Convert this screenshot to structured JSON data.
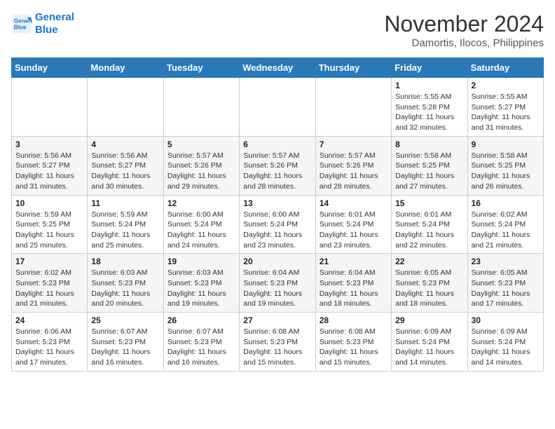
{
  "logo": {
    "line1": "General",
    "line2": "Blue"
  },
  "title": "November 2024",
  "subtitle": "Damortis, Ilocos, Philippines",
  "days_of_week": [
    "Sunday",
    "Monday",
    "Tuesday",
    "Wednesday",
    "Thursday",
    "Friday",
    "Saturday"
  ],
  "weeks": [
    [
      {
        "day": "",
        "info": ""
      },
      {
        "day": "",
        "info": ""
      },
      {
        "day": "",
        "info": ""
      },
      {
        "day": "",
        "info": ""
      },
      {
        "day": "",
        "info": ""
      },
      {
        "day": "1",
        "info": "Sunrise: 5:55 AM\nSunset: 5:28 PM\nDaylight: 11 hours and 32 minutes."
      },
      {
        "day": "2",
        "info": "Sunrise: 5:55 AM\nSunset: 5:27 PM\nDaylight: 11 hours and 31 minutes."
      }
    ],
    [
      {
        "day": "3",
        "info": "Sunrise: 5:56 AM\nSunset: 5:27 PM\nDaylight: 11 hours and 31 minutes."
      },
      {
        "day": "4",
        "info": "Sunrise: 5:56 AM\nSunset: 5:27 PM\nDaylight: 11 hours and 30 minutes."
      },
      {
        "day": "5",
        "info": "Sunrise: 5:57 AM\nSunset: 5:26 PM\nDaylight: 11 hours and 29 minutes."
      },
      {
        "day": "6",
        "info": "Sunrise: 5:57 AM\nSunset: 5:26 PM\nDaylight: 11 hours and 28 minutes."
      },
      {
        "day": "7",
        "info": "Sunrise: 5:57 AM\nSunset: 5:26 PM\nDaylight: 11 hours and 28 minutes."
      },
      {
        "day": "8",
        "info": "Sunrise: 5:58 AM\nSunset: 5:25 PM\nDaylight: 11 hours and 27 minutes."
      },
      {
        "day": "9",
        "info": "Sunrise: 5:58 AM\nSunset: 5:25 PM\nDaylight: 11 hours and 26 minutes."
      }
    ],
    [
      {
        "day": "10",
        "info": "Sunrise: 5:59 AM\nSunset: 5:25 PM\nDaylight: 11 hours and 25 minutes."
      },
      {
        "day": "11",
        "info": "Sunrise: 5:59 AM\nSunset: 5:24 PM\nDaylight: 11 hours and 25 minutes."
      },
      {
        "day": "12",
        "info": "Sunrise: 6:00 AM\nSunset: 5:24 PM\nDaylight: 11 hours and 24 minutes."
      },
      {
        "day": "13",
        "info": "Sunrise: 6:00 AM\nSunset: 5:24 PM\nDaylight: 11 hours and 23 minutes."
      },
      {
        "day": "14",
        "info": "Sunrise: 6:01 AM\nSunset: 5:24 PM\nDaylight: 11 hours and 23 minutes."
      },
      {
        "day": "15",
        "info": "Sunrise: 6:01 AM\nSunset: 5:24 PM\nDaylight: 11 hours and 22 minutes."
      },
      {
        "day": "16",
        "info": "Sunrise: 6:02 AM\nSunset: 5:24 PM\nDaylight: 11 hours and 21 minutes."
      }
    ],
    [
      {
        "day": "17",
        "info": "Sunrise: 6:02 AM\nSunset: 5:23 PM\nDaylight: 11 hours and 21 minutes."
      },
      {
        "day": "18",
        "info": "Sunrise: 6:03 AM\nSunset: 5:23 PM\nDaylight: 11 hours and 20 minutes."
      },
      {
        "day": "19",
        "info": "Sunrise: 6:03 AM\nSunset: 5:23 PM\nDaylight: 11 hours and 19 minutes."
      },
      {
        "day": "20",
        "info": "Sunrise: 6:04 AM\nSunset: 5:23 PM\nDaylight: 11 hours and 19 minutes."
      },
      {
        "day": "21",
        "info": "Sunrise: 6:04 AM\nSunset: 5:23 PM\nDaylight: 11 hours and 18 minutes."
      },
      {
        "day": "22",
        "info": "Sunrise: 6:05 AM\nSunset: 5:23 PM\nDaylight: 11 hours and 18 minutes."
      },
      {
        "day": "23",
        "info": "Sunrise: 6:05 AM\nSunset: 5:23 PM\nDaylight: 11 hours and 17 minutes."
      }
    ],
    [
      {
        "day": "24",
        "info": "Sunrise: 6:06 AM\nSunset: 5:23 PM\nDaylight: 11 hours and 17 minutes."
      },
      {
        "day": "25",
        "info": "Sunrise: 6:07 AM\nSunset: 5:23 PM\nDaylight: 11 hours and 16 minutes."
      },
      {
        "day": "26",
        "info": "Sunrise: 6:07 AM\nSunset: 5:23 PM\nDaylight: 11 hours and 16 minutes."
      },
      {
        "day": "27",
        "info": "Sunrise: 6:08 AM\nSunset: 5:23 PM\nDaylight: 11 hours and 15 minutes."
      },
      {
        "day": "28",
        "info": "Sunrise: 6:08 AM\nSunset: 5:23 PM\nDaylight: 11 hours and 15 minutes."
      },
      {
        "day": "29",
        "info": "Sunrise: 6:09 AM\nSunset: 5:24 PM\nDaylight: 11 hours and 14 minutes."
      },
      {
        "day": "30",
        "info": "Sunrise: 6:09 AM\nSunset: 5:24 PM\nDaylight: 11 hours and 14 minutes."
      }
    ]
  ]
}
